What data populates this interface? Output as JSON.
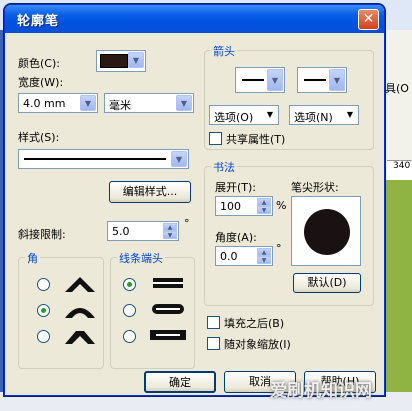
{
  "window": {
    "title": "轮廓笔",
    "close_glyph": "✕"
  },
  "background": {
    "menu_fragment": "具(O",
    "ruler_number": "340"
  },
  "color": {
    "label": "颜色(C):",
    "swatch": "#2a1a12"
  },
  "width": {
    "label": "宽度(W):",
    "value": "4.0 mm",
    "unit": "毫米"
  },
  "style": {
    "label": "样式(S):",
    "edit_button": "编辑样式..."
  },
  "miter": {
    "label": "斜接限制:",
    "value": "5.0",
    "unit": "°"
  },
  "corner": {
    "title": "角",
    "options": [
      "miter",
      "round",
      "bevel"
    ],
    "selected": 1
  },
  "line_caps": {
    "title": "线条端头",
    "options": [
      "butt",
      "round",
      "square"
    ],
    "selected": 0
  },
  "arrows": {
    "title": "箭头",
    "options_start_label": "选项(O)",
    "options_end_label": "选项(N)",
    "share_attributes_label": "共享属性(T)"
  },
  "calligraphy": {
    "title": "书法",
    "stretch_label": "展开(T):",
    "stretch_value": "100",
    "stretch_unit": "%",
    "angle_label": "角度(A):",
    "angle_value": "0.0",
    "angle_unit": "°",
    "nib_label": "笔尖形状:",
    "default_button": "默认(D)"
  },
  "fill_behind_label": "填充之后(B)",
  "scale_with_image_label": "随对象缩放(I)",
  "buttons": {
    "ok": "确定",
    "cancel": "取消",
    "help": "帮助(H)"
  },
  "watermark": "爱刷机知识网"
}
